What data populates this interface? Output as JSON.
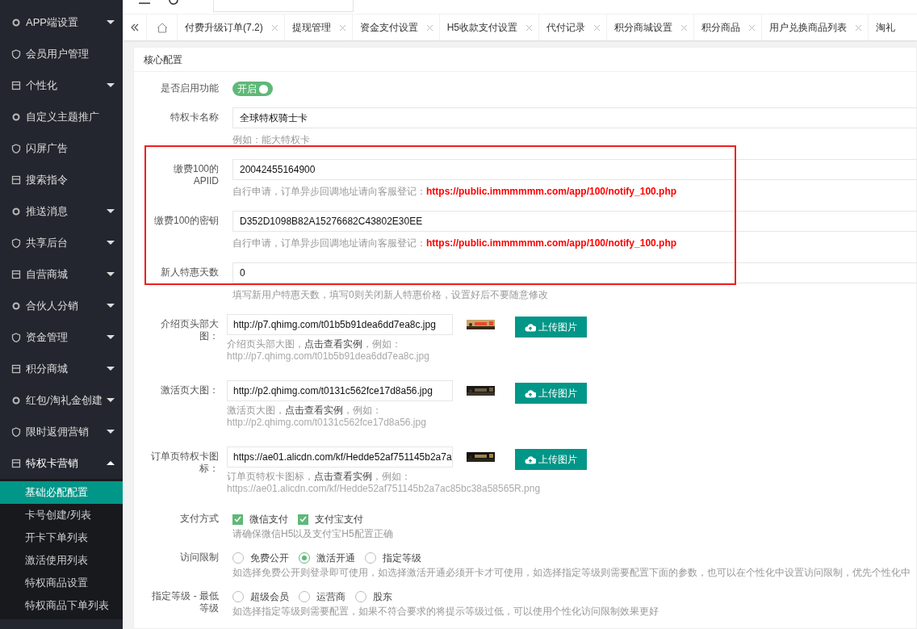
{
  "sidebar": {
    "items": [
      {
        "label": "APP端设置",
        "expanded": false
      },
      {
        "label": "会员用户管理"
      },
      {
        "label": "个性化",
        "expanded": false
      },
      {
        "label": "自定义主题推广"
      },
      {
        "label": "闪屏广告"
      },
      {
        "label": "搜索指令"
      },
      {
        "label": "推送消息",
        "expanded": false
      },
      {
        "label": "共享后台",
        "expanded": false
      },
      {
        "label": "自营商城",
        "expanded": false
      },
      {
        "label": "合伙人分销",
        "expanded": false
      },
      {
        "label": "资金管理",
        "expanded": false
      },
      {
        "label": "积分商城",
        "expanded": false
      },
      {
        "label": "红包/淘礼金创建",
        "expanded": false
      },
      {
        "label": "限时返佣营销",
        "expanded": false
      },
      {
        "label": "特权卡营销",
        "expanded": true,
        "children": [
          {
            "label": "基础必配配置",
            "selected": true
          },
          {
            "label": "卡号创建/列表",
            "selected": false
          },
          {
            "label": "开卡下单列表",
            "selected": false
          },
          {
            "label": "激活使用列表",
            "selected": false
          },
          {
            "label": "特权商品设置",
            "selected": false
          },
          {
            "label": "特权商品下单列表",
            "selected": false
          }
        ]
      }
    ]
  },
  "tabs": [
    {
      "label": "付费升级订单(7.2)",
      "closable": true
    },
    {
      "label": "提现管理",
      "closable": true
    },
    {
      "label": "资金支付设置",
      "closable": true
    },
    {
      "label": "H5收款支付设置",
      "closable": true
    },
    {
      "label": "代付记录",
      "closable": true
    },
    {
      "label": "积分商城设置",
      "closable": true
    },
    {
      "label": "积分商品",
      "closable": true
    },
    {
      "label": "用户兑换商品列表",
      "closable": true
    },
    {
      "label": "淘礼",
      "closable": false
    }
  ],
  "card": {
    "title": "核心配置",
    "fields": [
      {
        "kind": "switch",
        "label": "是否启用功能",
        "on": true,
        "text": "开启"
      },
      {
        "kind": "input",
        "label": "特权卡名称",
        "value": "全球特权骑士卡",
        "help": "例如：能大特权卡"
      },
      {
        "kind": "input",
        "label": "缴费100的APIID",
        "value": "20042455164900",
        "help": "自行申请，订单异步回调地址请向客服登记：",
        "help_link": "https://public.immmmmm.com/app/100/notify_100.php"
      },
      {
        "kind": "input",
        "label": "缴费100的密钥",
        "value": "D352D1098B82A15276682C43802E30EE",
        "help": "自行申请，订单异步回调地址请向客服登记：",
        "help_link": "https://public.immmmmm.com/app/100/notify_100.php"
      },
      {
        "kind": "input",
        "label": "新人特惠天数",
        "value": "0",
        "help": "填写新用户特惠天数，填写0则关闭新人特惠价格，设置好后不要随意修改"
      },
      {
        "label": "介绍页头部大图：",
        "value": "http://p7.qhimg.com/t01b5b91dea6dd7ea8c.jpg",
        "help": "介绍页头部大图，**点击查看实例**，例如：",
        "example": "http://p7.qhimg.com/t01b5b91dea6dd7ea8c.jpg",
        "button": "上传图片"
      },
      {
        "label": "激活页大图：",
        "value": "http://p2.qhimg.com/t0131c562fce17d8a56.jpg",
        "help": "激活页大图，**点击查看实例**，例如：",
        "example": "http://p2.qhimg.com/t0131c562fce17d8a56.jpg",
        "button": "上传图片"
      },
      {
        "label": "订单页特权卡图标：",
        "value": "https://ae01.alicdn.com/kf/Hedde52af751145b2a7a",
        "help": "订单页特权卡图标，**点击查看实例**，例如：",
        "example": "https://ae01.alicdn.com/kf/Hedde52af751145b2a7ac85bc38a58565R.png",
        "button": "上传图片"
      },
      {
        "kind": "checkboxes",
        "label": "支付方式",
        "options": [
          {
            "label": "微信支付",
            "checked": true
          },
          {
            "label": "支付宝支付",
            "checked": true
          }
        ],
        "help": "请确保微信H5以及支付宝H5配置正确"
      },
      {
        "kind": "radios",
        "label": "访问限制",
        "options": [
          {
            "label": "免费公开",
            "selected": false
          },
          {
            "label": "激活开通",
            "selected": true
          },
          {
            "label": "指定等级",
            "selected": false
          }
        ],
        "help": "如选择免费公开则登录即可使用，如选择激活开通必须开卡才可使用，如选择指定等级则需要配置下面的参数，也可以在个性化中设置访问限制，优先个性化中"
      },
      {
        "kind": "radios",
        "label": "指定等级 - 最低等级",
        "options": [
          {
            "label": "超级会员",
            "selected": false
          },
          {
            "label": "运营商",
            "selected": false
          },
          {
            "label": "股东",
            "selected": false
          }
        ],
        "help": "如选择指定等级则需要配置，如果不符合要求的将提示等级过低，可以使用个性化访问限制效果更好"
      }
    ]
  }
}
